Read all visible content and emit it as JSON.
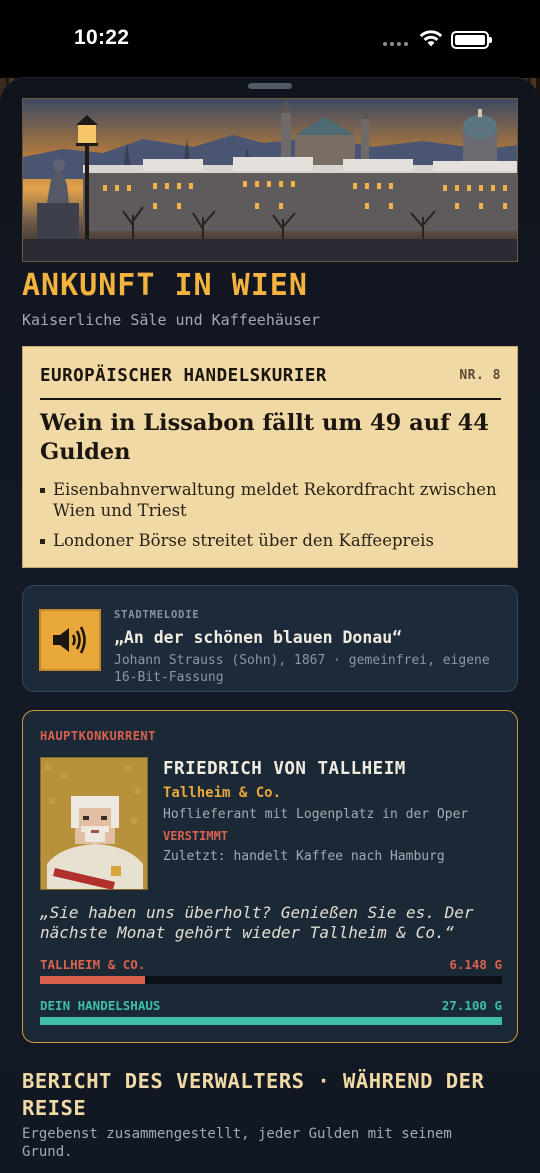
{
  "status_bar": {
    "time": "10:22"
  },
  "header": {
    "title": "ANKUNFT IN WIEN",
    "subtitle": "Kaiserliche Säle und Kaffeehäuser"
  },
  "newspaper": {
    "masthead": "EUROPÄISCHER HANDELSKURIER",
    "issue": "NR. 8",
    "headline": "Wein in Lissabon fällt um 49 auf 44 Gulden",
    "bullets": [
      "Eisenbahnverwaltung meldet Rekordfracht zwischen Wien und Triest",
      "Londoner Börse streitet über den Kaffeepreis"
    ]
  },
  "music": {
    "kicker": "STADTMELODIE",
    "title": "„An der schönen blauen Donau“",
    "meta": "Johann Strauss (Sohn), 1867 · gemeinfrei, eigene 16-Bit-Fassung",
    "icon": "speaker-icon"
  },
  "rival": {
    "kicker": "HAUPTKONKURRENT",
    "name": "FRIEDRICH VON TALLHEIM",
    "company": "Tallheim & Co.",
    "description": "Hoflieferant mit Logenplatz in der Oper",
    "mood": "VERSTIMMT",
    "last_action": "Zuletzt: handelt Kaffee nach Hamburg",
    "quote": "„Sie haben uns überholt? Genießen Sie es. Der nächste Monat gehört wieder Tallheim & Co.“",
    "comparison": [
      {
        "label": "TALLHEIM & CO.",
        "value": "6.148 G",
        "fraction": 0.227,
        "color": "#d9624f"
      },
      {
        "label": "DEIN HANDELSHAUS",
        "value": "27.100 G",
        "fraction": 1.0,
        "color": "#3fbfa8"
      }
    ]
  },
  "report": {
    "title": "BERICHT DES VERWALTERS · WÄHREND DER REISE",
    "subtitle": "Ergebenst zusammengestellt, jeder Gulden mit seinem Grund."
  },
  "colors": {
    "accent_gold": "#f4b23e",
    "paper": "#f1d9a5",
    "rival_red": "#d9624f",
    "player_teal": "#3fbfa8"
  }
}
